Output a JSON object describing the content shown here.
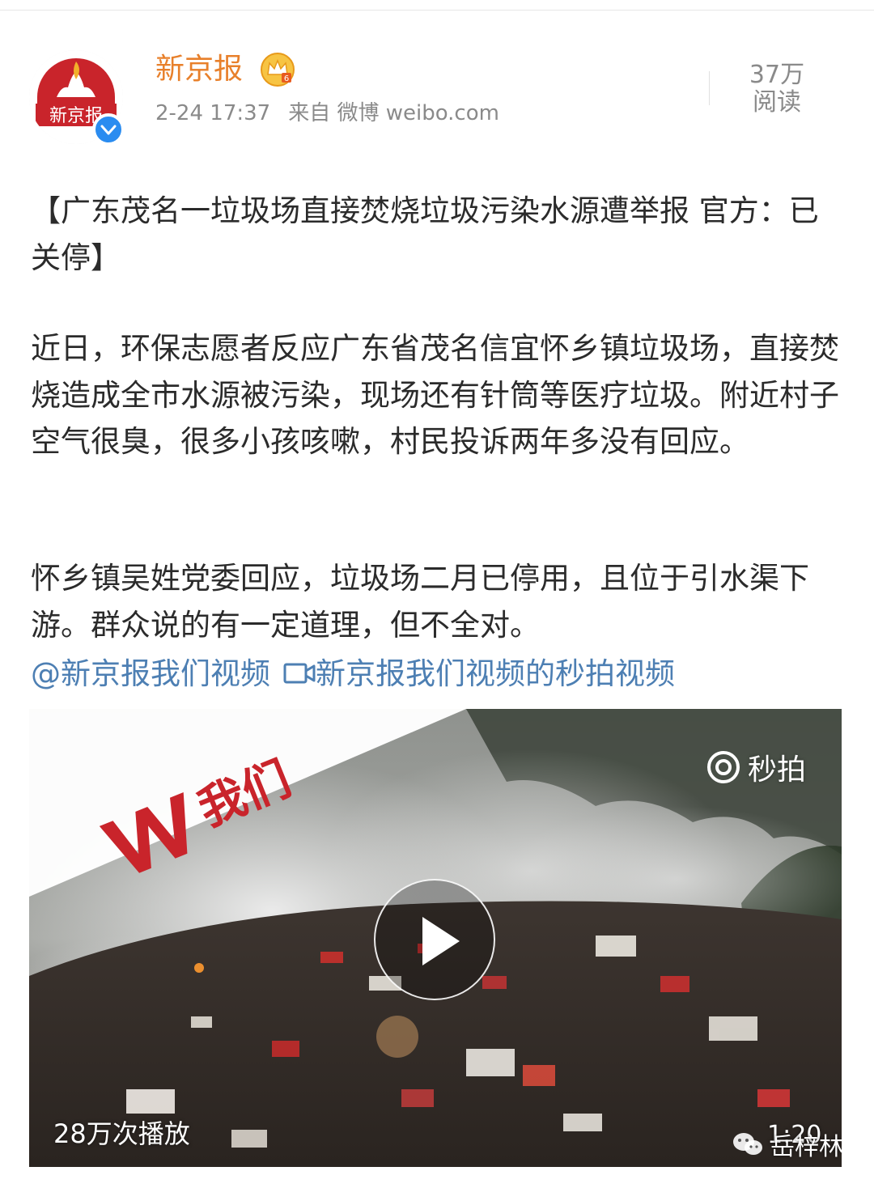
{
  "post": {
    "author": "新京报",
    "time": "2-24 17:37",
    "source": "来自 微博 weibo.com",
    "read_count": "37万",
    "read_label": "阅读",
    "title": "【广东茂名一垃圾场直接焚烧垃圾污染水源遭举报 官方：已关停】",
    "paragraph1": "近日，环保志愿者反应广东省茂名信宜怀乡镇垃圾场，直接焚烧造成全市水源被污染，现场还有针筒等医疗垃圾。附近村子空气很臭，很多小孩咳嗽，村民投诉两年多没有回应。",
    "paragraph2": "怀乡镇吴姓党委回应，垃圾场二月已停用，且位于引水渠下游。群众说的有一定道理，但不全对。",
    "mention": "@新京报我们视频",
    "video_link": "新京报我们视频的秒拍视频"
  },
  "avatar_text": "新京报",
  "video": {
    "logo_text": "我们",
    "platform": "秒拍",
    "play_count": "28万次播放",
    "duration": "1:20",
    "watermark": "岳梓林"
  },
  "colors": {
    "author": "#e8802b",
    "link": "#4d7fb3",
    "verified": "#2a8cf0",
    "logo_red": "#c9242b"
  }
}
